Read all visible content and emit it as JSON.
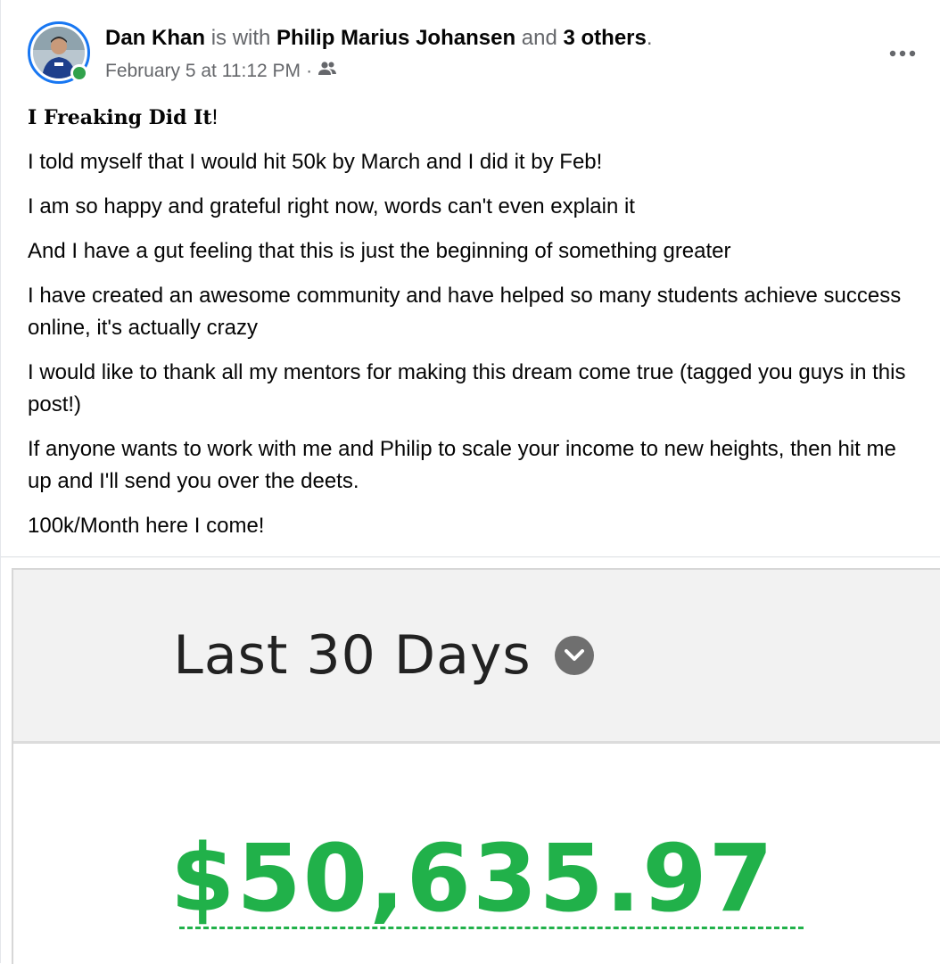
{
  "post": {
    "author": "Dan Khan",
    "with_text": "is with",
    "tagged": "Philip Marius Johansen",
    "and_text": "and",
    "others": "3 others",
    "period": ".",
    "timestamp": "February 5 at 11:12 PM",
    "separator": "·",
    "audience_icon": "friends-icon",
    "more_icon": "more-options-icon",
    "headline": "I Freaking Did It",
    "headline_punct": "!",
    "lines": [
      "I told myself that I would hit 50k by March and I did it by Feb!",
      "I am so happy and grateful right now, words can't even explain it",
      "And I have a gut feeling that this is just the beginning of something greater",
      "I have created an awesome community and have helped so many students achieve success online, it's actually crazy",
      "I would like to thank all my mentors for making this dream come true (tagged you guys in this post!)",
      "If anyone wants to work with me and Philip to scale your income to new heights, then hit me up and I'll send you over the deets.",
      "100k/Month here I come!"
    ]
  },
  "photo": {
    "range_label": "Last 30 Days",
    "amount": "$50,635.97",
    "amount_color": "#21b14a"
  },
  "colors": {
    "accent": "#1877f2",
    "online": "#31a24c",
    "muted_text": "#65676b"
  }
}
